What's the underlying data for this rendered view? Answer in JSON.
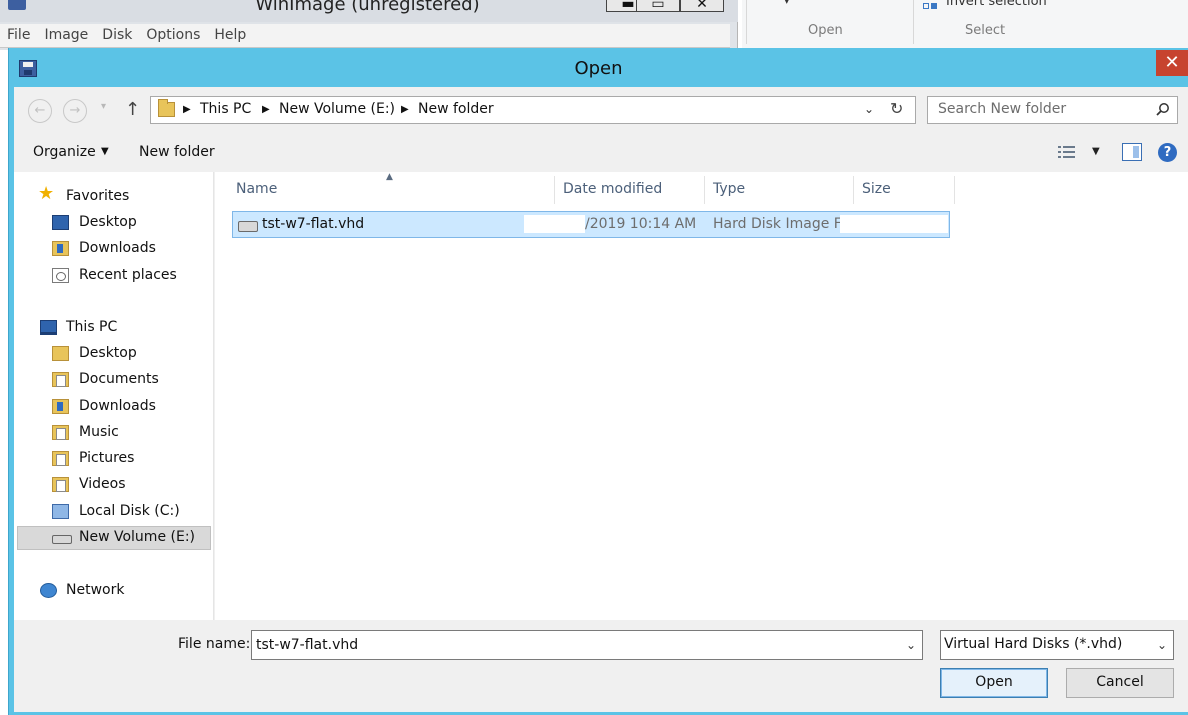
{
  "background_window": {
    "title": "WinImage (unregistered)",
    "menu": [
      "File",
      "Image",
      "Disk",
      "Options",
      "Help"
    ],
    "controls": {
      "minimize": "▬",
      "maximize": "▭",
      "close": "✕"
    }
  },
  "background_ribbon": {
    "open_group_label": "Open",
    "select_group_label": "Select",
    "invert_selection_label": "Invert selection",
    "dropdown_glyph": "▾"
  },
  "dialog": {
    "title": "Open",
    "close_glyph": "✕",
    "nav": {
      "back_glyph": "←",
      "forward_glyph": "→",
      "recent_glyph": "▾",
      "up_glyph": "↑"
    },
    "breadcrumb": [
      "This PC",
      "New Volume (E:)",
      "New folder"
    ],
    "breadcrumb_sep": "▶",
    "address_dropdown_glyph": "⌄",
    "refresh_glyph": "↻",
    "search": {
      "placeholder": "Search New folder"
    },
    "toolbar": {
      "organize_label": "Organize",
      "organize_caret": "▼",
      "new_folder_label": "New folder",
      "view_caret": "▼",
      "help_glyph": "?"
    },
    "nav_pane": {
      "favorites": {
        "label": "Favorites",
        "icon": "star-icon"
      },
      "favorites_items": [
        {
          "label": "Desktop",
          "icon": "desktop-icon"
        },
        {
          "label": "Downloads",
          "icon": "downloads-folder-icon"
        },
        {
          "label": "Recent places",
          "icon": "recent-places-icon"
        }
      ],
      "this_pc": {
        "label": "This PC",
        "icon": "computer-icon"
      },
      "this_pc_items": [
        {
          "label": "Desktop",
          "icon": "folder-icon"
        },
        {
          "label": "Documents",
          "icon": "documents-folder-icon"
        },
        {
          "label": "Downloads",
          "icon": "downloads-folder-icon"
        },
        {
          "label": "Music",
          "icon": "music-folder-icon"
        },
        {
          "label": "Pictures",
          "icon": "pictures-folder-icon"
        },
        {
          "label": "Videos",
          "icon": "videos-folder-icon"
        },
        {
          "label": "Local Disk (C:)",
          "icon": "system-drive-icon"
        },
        {
          "label": "New Volume (E:)",
          "icon": "drive-icon",
          "selected": true
        }
      ],
      "network": {
        "label": "Network",
        "icon": "network-icon"
      }
    },
    "file_list": {
      "columns": [
        "Name",
        "Date modified",
        "Type",
        "Size"
      ],
      "sort_glyph": "▲",
      "rows": [
        {
          "name": "tst-w7-flat.vhd",
          "date_modified": "/2019 10:14 AM",
          "type": "Hard Disk Image F...",
          "icon": "disk-image-icon",
          "selected": true
        }
      ]
    },
    "file_name_label": "File name:",
    "file_name_value": "tst-w7-flat.vhd",
    "file_type_value": "Virtual Hard Disks (*.vhd)",
    "dropdown_glyph": "⌄",
    "open_label": "Open",
    "cancel_label": "Cancel"
  },
  "colors": {
    "dialog_frame": "#5bc3e6",
    "selection": "#cce8ff",
    "close_button": "#c7432f"
  }
}
